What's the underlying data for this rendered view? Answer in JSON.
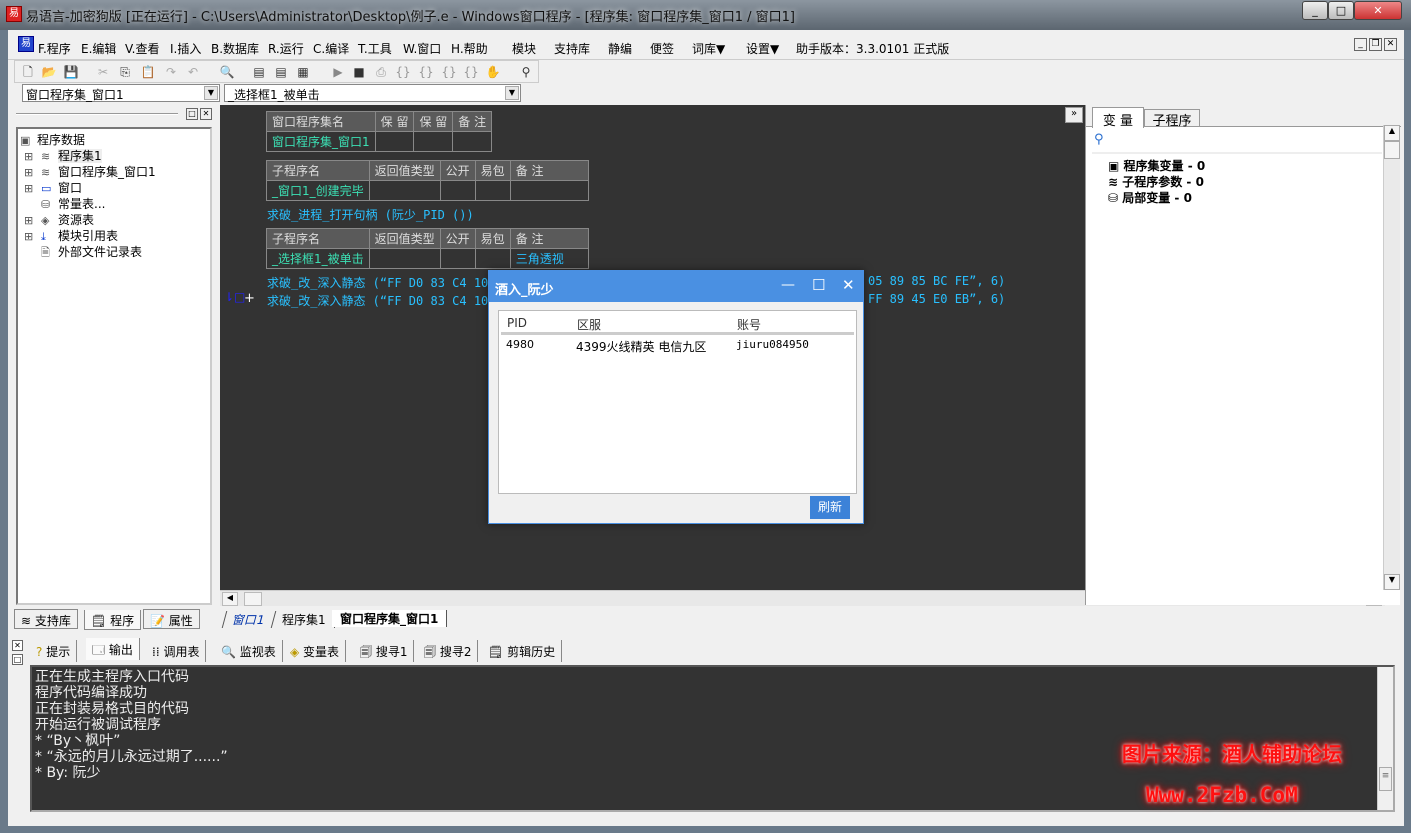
{
  "window": {
    "title": "易语言-加密狗版 [正在运行] - C:\\Users\\Administrator\\Desktop\\例子.e - Windows窗口程序 - [程序集: 窗口程序集_窗口1 / 窗口1]"
  },
  "menu": [
    "F.程序",
    "E.编辑",
    "V.查看",
    "I.插入",
    "B.数据库",
    "R.运行",
    "C.编译",
    "T.工具",
    "W.窗口",
    "H.帮助",
    "模块",
    "支持库",
    "静编",
    "便签",
    "词库▼",
    "设置▼"
  ],
  "version": "助手版本：3.3.0101 正式版",
  "combos": {
    "assembly": "窗口程序集_窗口1",
    "subroutine": "_选择框1_被单击"
  },
  "tree": {
    "root": "程序数据",
    "items": [
      "程序集1",
      "窗口程序集_窗口1",
      "窗口",
      "常量表...",
      "资源表",
      "模块引用表",
      "外部文件记录表"
    ]
  },
  "left_tabs": [
    "支持库",
    "程序",
    "属性"
  ],
  "code": {
    "table1": {
      "headers": [
        "窗口程序集名",
        "保 留",
        "保 留",
        "备 注"
      ],
      "row": [
        "窗口程序集_窗口1",
        "",
        "",
        ""
      ]
    },
    "table2": {
      "headers": [
        "子程序名",
        "返回值类型",
        "公开",
        "易包",
        "备 注"
      ],
      "row": [
        "_窗口1_创建完毕",
        "",
        "",
        "",
        ""
      ]
    },
    "line1": "求破_进程_打开句柄 (阮少_PID ())",
    "table3": {
      "headers": [
        "子程序名",
        "返回值类型",
        "公开",
        "易包",
        "备 注"
      ],
      "row": [
        "_选择框1_被单击",
        "",
        "",
        "",
        "三角透视"
      ]
    },
    "line2_left": "求破_改_深入静态 (“FF D0 83 C4 10 C1",
    "line2_right": "05 89 85 BC FE”, 6)",
    "line3_left": "求破_改_深入静态 (“FF D0 83 C4 10 8E",
    "line3_right": "FF 89 45 E0 EB”, 6)"
  },
  "right_panel": {
    "tabs": [
      "变 量",
      "子程序"
    ],
    "items": [
      "程序集变量 - 0",
      "子程序参数 - 0",
      "局部变量 - 0"
    ]
  },
  "editor_tabs": [
    "窗口1",
    "程序集1",
    "窗口程序集_窗口1"
  ],
  "bottom_tabs": [
    "提示",
    "输出",
    "调用表",
    "监视表",
    "变量表",
    "搜寻1",
    "搜寻2",
    "剪辑历史"
  ],
  "output_lines": [
    "正在生成主程序入口代码",
    "程序代码编译成功",
    "正在封装易格式目的代码",
    "开始运行被调试程序",
    "* “By丶枫叶”",
    "* “永远的月儿永远过期了......”",
    "* By: 阮少"
  ],
  "dialog": {
    "title": "酒入_阮少",
    "columns": [
      "PID",
      "区服",
      "账号"
    ],
    "rows": [
      [
        "4980",
        "4399火线精英 电信九区",
        "jiuru084950"
      ]
    ],
    "refresh": "刷新",
    "accent": "#4a90e2"
  },
  "watermark": {
    "line1": "图片来源：酒人辅助论坛",
    "line2": "Www.2Fzb.CoM"
  }
}
